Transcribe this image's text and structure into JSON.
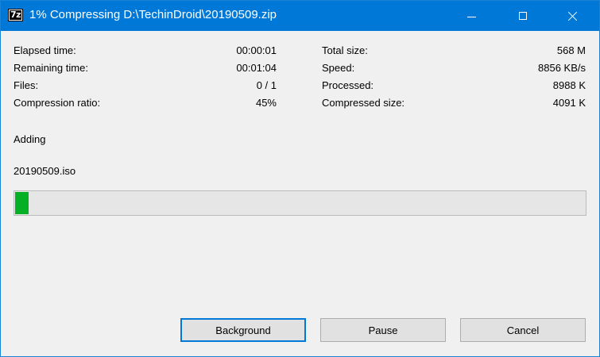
{
  "window": {
    "title": "1% Compressing D:\\TechinDroid\\20190509.zip",
    "app_icon_text": "7z"
  },
  "stats_left": [
    {
      "label": "Elapsed time:",
      "value": "00:00:01"
    },
    {
      "label": "Remaining time:",
      "value": "00:01:04"
    },
    {
      "label": "Files:",
      "value": "0 / 1"
    },
    {
      "label": "Compression ratio:",
      "value": "45%"
    }
  ],
  "stats_right": [
    {
      "label": "Total size:",
      "value": "568 M"
    },
    {
      "label": "Speed:",
      "value": "8856 KB/s"
    },
    {
      "label": "Processed:",
      "value": "8988 K"
    },
    {
      "label": "Compressed size:",
      "value": "4091 K"
    }
  ],
  "status": {
    "operation": "Adding",
    "current_file": "20190509.iso"
  },
  "progress": {
    "percent": 1,
    "fill_color": "#06b025"
  },
  "buttons": {
    "background": "Background",
    "pause": "Pause",
    "cancel": "Cancel"
  },
  "colors": {
    "titlebar": "#0078d7",
    "window_bg": "#f0f0f0",
    "default_button_border": "#0078d7"
  }
}
